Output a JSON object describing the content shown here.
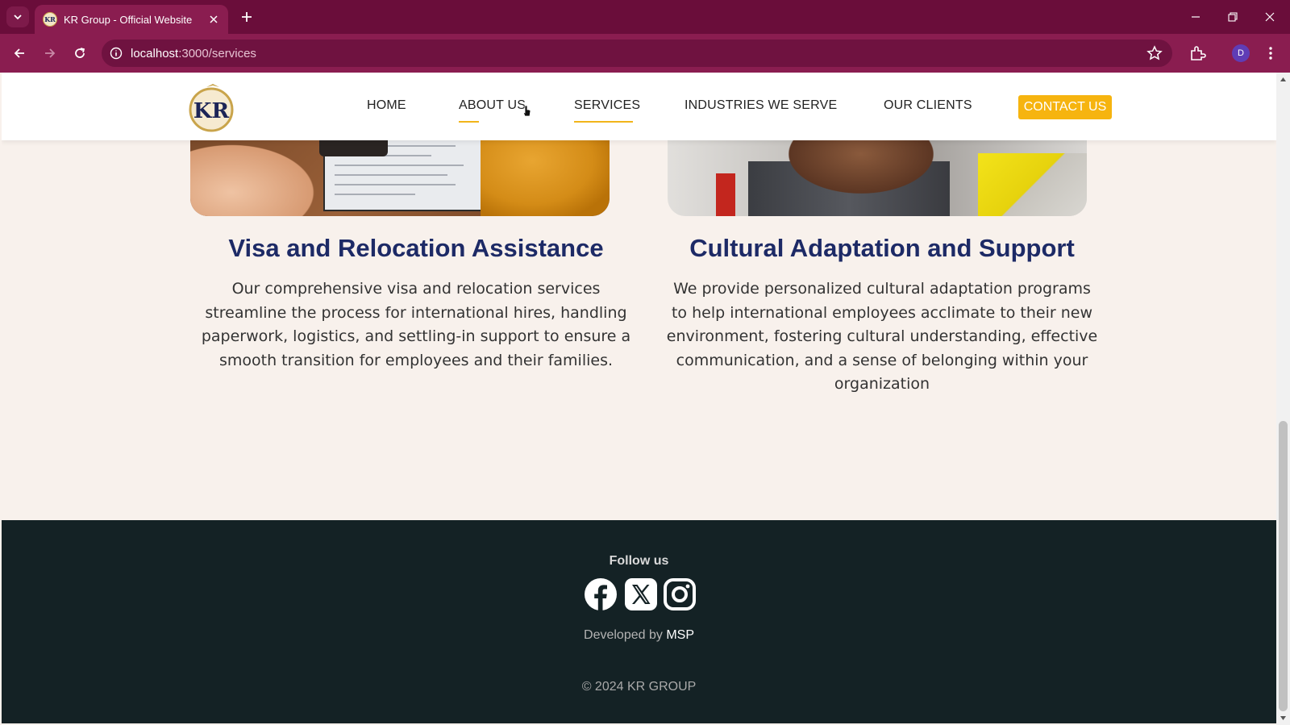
{
  "browser": {
    "tab_title": "KR Group - Official Website",
    "favicon_text": "KR",
    "url_host": "localhost",
    "url_path": ":3000/services",
    "profile_initial": "D"
  },
  "header": {
    "logo_text": "KR",
    "nav": {
      "home": "HOME",
      "about": "ABOUT US",
      "services": "SERVICES",
      "industries": "INDUSTRIES  WE  SERVE",
      "clients": "OUR CLIENTS",
      "contact": "CONTACT US"
    },
    "accent_color": "#f6b40f"
  },
  "services": [
    {
      "title": "Visa and Relocation Assistance",
      "description": "Our comprehensive visa and relocation services streamline the process for international hires, handling paperwork, logistics, and settling-in support to ensure a smooth transition for employees and their families."
    },
    {
      "title": "Cultural Adaptation and Support",
      "description": "We provide personalized cultural adaptation programs to help international employees acclimate to their new environment, fostering cultural understanding, effective communication, and a sense of belonging within your organization"
    }
  ],
  "footer": {
    "follow_label": "Follow us",
    "social_icons": [
      "facebook-icon",
      "x-icon",
      "instagram-icon"
    ],
    "developed_prefix": "Developed by ",
    "developer": "MSP",
    "copyright": "© 2024 KR GROUP"
  }
}
